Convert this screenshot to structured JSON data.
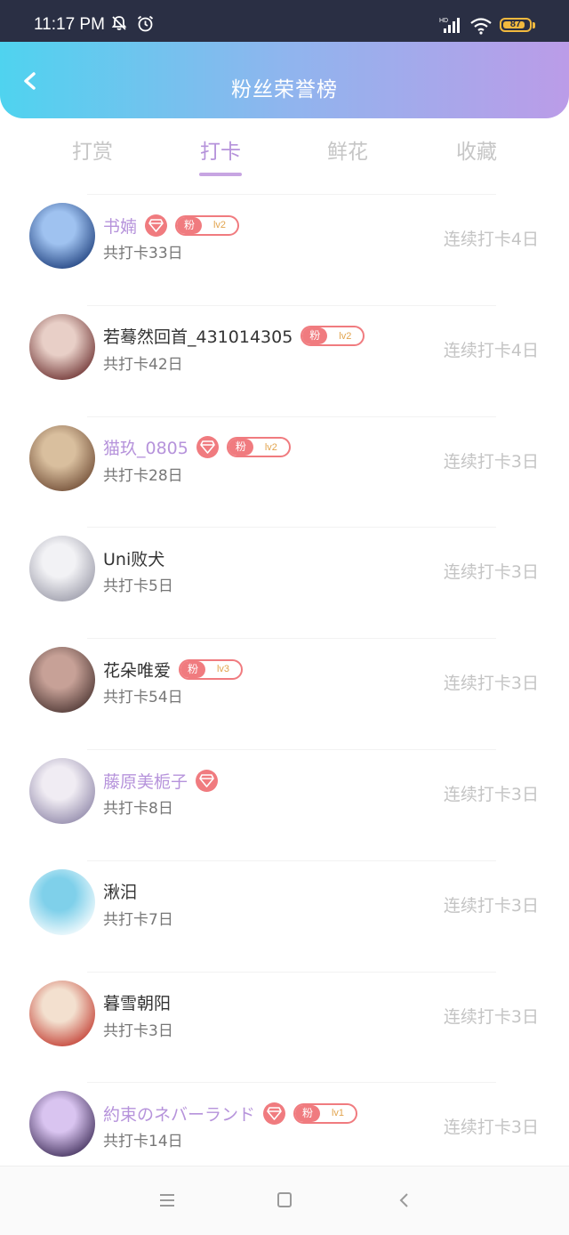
{
  "status_bar": {
    "time": "11:17 PM",
    "icons": [
      "silent-icon",
      "alarm-icon",
      "signal-icon",
      "wifi-icon"
    ],
    "battery": 87,
    "battery_color": "#f1b93e"
  },
  "header": {
    "title": "粉丝荣誉榜",
    "gradient": [
      "#4fd3ef",
      "#bb9ce8"
    ]
  },
  "tabs": [
    {
      "label": "打赏",
      "active": false
    },
    {
      "label": "打卡",
      "active": true
    },
    {
      "label": "鲜花",
      "active": false
    },
    {
      "label": "收藏",
      "active": false
    }
  ],
  "fan_badge_label": "粉",
  "rows": [
    {
      "name": "书婻",
      "vip": true,
      "gem": true,
      "level": "lv2",
      "total": "共打卡33日",
      "streak": "连续打卡4日",
      "avatar_colors": [
        "#9fc2f0",
        "#1b3c7a"
      ]
    },
    {
      "name": "若蓦然回首_431014305",
      "vip": false,
      "gem": false,
      "level": "lv2",
      "total": "共打卡42日",
      "streak": "连续打卡4日",
      "avatar_colors": [
        "#e8cfc7",
        "#6a2d2d"
      ]
    },
    {
      "name": "猫玖_0805",
      "vip": true,
      "gem": true,
      "level": "lv2",
      "total": "共打卡28日",
      "streak": "连续打卡3日",
      "avatar_colors": [
        "#d9bf9e",
        "#6e4a33"
      ]
    },
    {
      "name": "Uni败犬",
      "vip": false,
      "gem": false,
      "level": null,
      "total": "共打卡5日",
      "streak": "连续打卡3日",
      "avatar_colors": [
        "#f2f2f5",
        "#9a9aa8"
      ]
    },
    {
      "name": "花朵唯爱",
      "vip": false,
      "gem": false,
      "level": "lv3",
      "total": "共打卡54日",
      "streak": "连续打卡3日",
      "avatar_colors": [
        "#c7a197",
        "#4a3431"
      ]
    },
    {
      "name": "藤原美栀子",
      "vip": true,
      "gem": true,
      "level": null,
      "total": "共打卡8日",
      "streak": "连续打卡3日",
      "avatar_colors": [
        "#f0ecf3",
        "#8e86a8"
      ]
    },
    {
      "name": "湫汨",
      "vip": false,
      "gem": false,
      "level": null,
      "total": "共打卡7日",
      "streak": "连续打卡3日",
      "avatar_colors": [
        "#7fd0ea",
        "#ffffff"
      ]
    },
    {
      "name": "暮雪朝阳",
      "vip": false,
      "gem": false,
      "level": null,
      "total": "共打卡3日",
      "streak": "连续打卡3日",
      "avatar_colors": [
        "#f3e0cf",
        "#c1382d"
      ]
    },
    {
      "name": "約束のネバーランド",
      "vip": true,
      "gem": true,
      "level": "lv1",
      "total": "共打卡14日",
      "streak": "连续打卡3日",
      "avatar_colors": [
        "#d9c4f0",
        "#3b2a55"
      ]
    }
  ],
  "nav_bar": {
    "buttons": [
      "menu-icon",
      "home-icon",
      "back-icon"
    ]
  }
}
